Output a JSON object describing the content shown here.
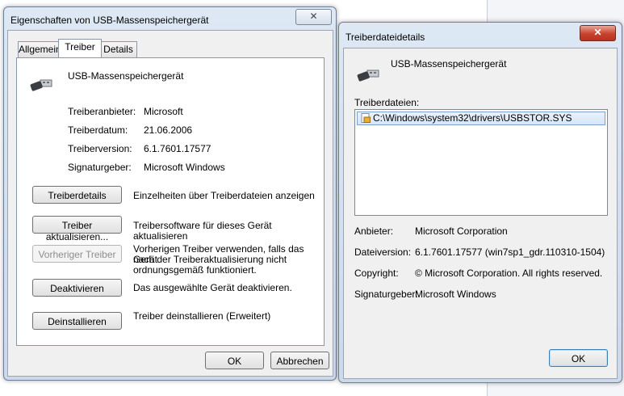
{
  "props": {
    "title": "Eigenschaften von USB-Massenspeichergerät",
    "close_label": "✕",
    "tabs": [
      "Allgemein",
      "Treiber",
      "Details"
    ],
    "device_name": "USB-Massenspeichergerät",
    "fields": [
      {
        "label": "Treiberanbieter:",
        "value": "Microsoft"
      },
      {
        "label": "Treiberdatum:",
        "value": "21.06.2006"
      },
      {
        "label": "Treiberversion:",
        "value": "6.1.7601.17577"
      },
      {
        "label": "Signaturgeber:",
        "value": "Microsoft Windows"
      }
    ],
    "actions": [
      {
        "button": "Treiberdetails",
        "desc": "Einzelheiten über Treiberdateien anzeigen"
      },
      {
        "button": "Treiber aktualisieren...",
        "desc": "Treibersoftware für dieses Gerät aktualisieren"
      },
      {
        "button": "Vorheriger Treiber",
        "desc1": "Vorherigen Treiber verwenden, falls das Gerät",
        "desc2": "nach der Treiberaktualisierung nicht",
        "desc3": "ordnungsgemäß funktioniert."
      },
      {
        "button": "Deaktivieren",
        "desc": "Das ausgewählte Gerät deaktivieren."
      },
      {
        "button": "Deinstallieren",
        "desc": "Treiber deinstallieren (Erweitert)"
      }
    ],
    "ok": "OK",
    "cancel": "Abbrechen"
  },
  "details": {
    "title": "Treiberdateidetails",
    "close_label": "✕",
    "device_name": "USB-Massenspeichergerät",
    "files_label": "Treiberdateien:",
    "files": [
      "C:\\Windows\\system32\\drivers\\USBSTOR.SYS"
    ],
    "fields": [
      {
        "label": "Anbieter:",
        "value": "Microsoft Corporation"
      },
      {
        "label": "Dateiversion:",
        "value": "6.1.7601.17577 (win7sp1_gdr.110310-1504)"
      },
      {
        "label": "Copyright:",
        "value": "© Microsoft Corporation. All rights reserved."
      },
      {
        "label": "Signaturgeber:",
        "value": "Microsoft Windows"
      }
    ],
    "ok": "OK"
  },
  "icons": {
    "usb": "usb-plug-icon",
    "file": "system-file-icon"
  }
}
